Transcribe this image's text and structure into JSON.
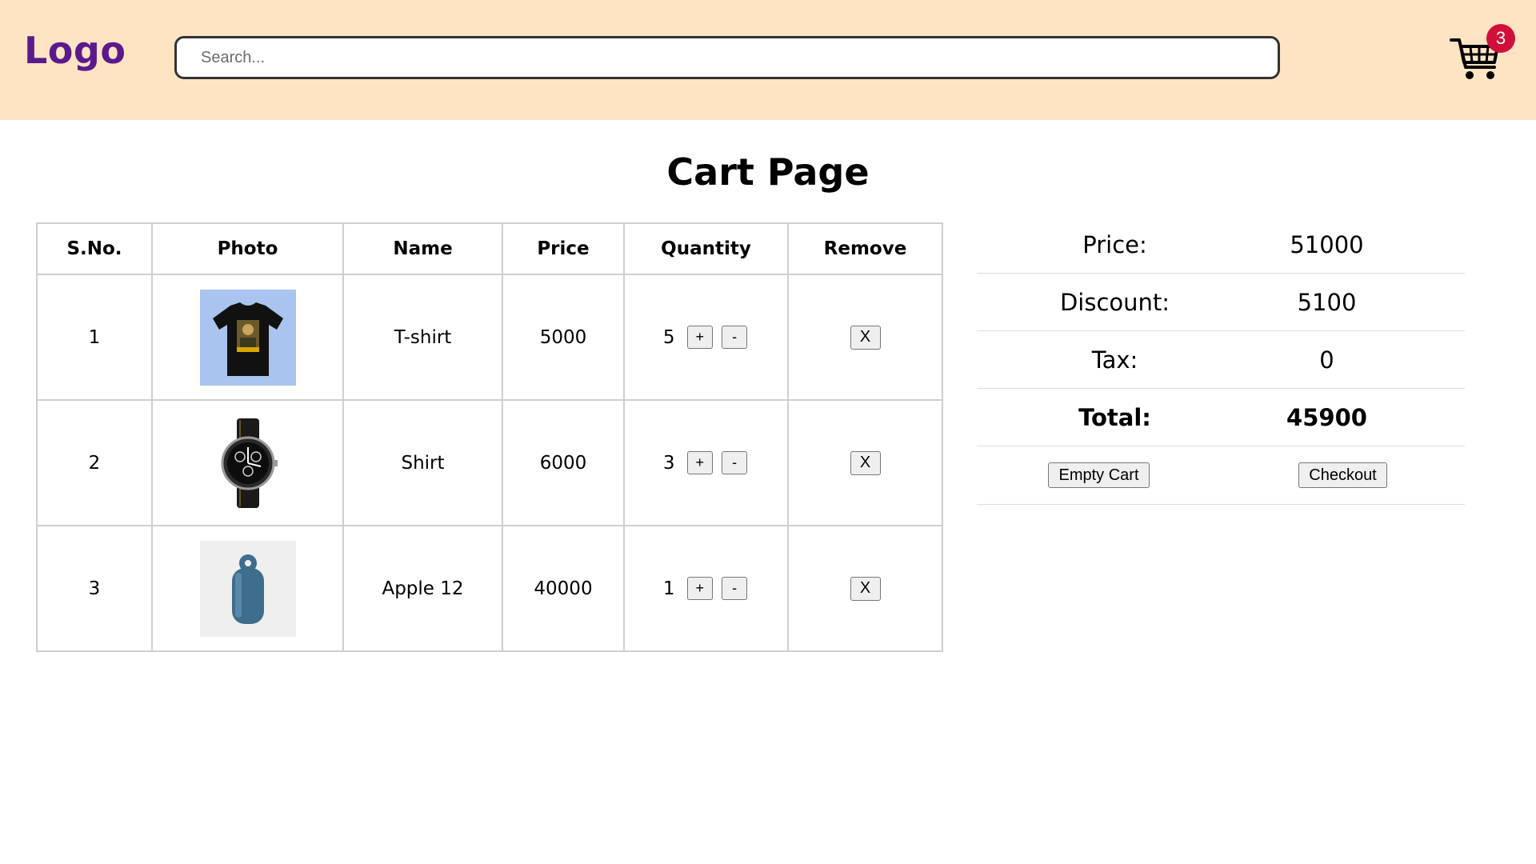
{
  "header": {
    "logo": "Logo",
    "search_placeholder": "Search...",
    "cart_count": "3"
  },
  "page": {
    "title": "Cart Page"
  },
  "table": {
    "headers": [
      "S.No.",
      "Photo",
      "Name",
      "Price",
      "Quantity",
      "Remove"
    ],
    "rows": [
      {
        "sno": "1",
        "name": "T-shirt",
        "price": "5000",
        "qty": "5",
        "photo": "tshirt-photo"
      },
      {
        "sno": "2",
        "name": "Shirt",
        "price": "6000",
        "qty": "3",
        "photo": "watch-photo"
      },
      {
        "sno": "3",
        "name": "Apple 12",
        "price": "40000",
        "qty": "1",
        "photo": "bottle-photo"
      }
    ],
    "plus_label": "+",
    "minus_label": "-",
    "remove_label": "X"
  },
  "summary": {
    "price_label": "Price:",
    "price_value": "51000",
    "discount_label": "Discount:",
    "discount_value": "5100",
    "tax_label": "Tax:",
    "tax_value": "0",
    "total_label": "Total:",
    "total_value": "45900",
    "empty_cart_label": "Empty Cart",
    "checkout_label": "Checkout"
  },
  "colors": {
    "header_bg": "#ffe4c4",
    "logo": "#5b1a8c",
    "badge": "#d0103a"
  }
}
